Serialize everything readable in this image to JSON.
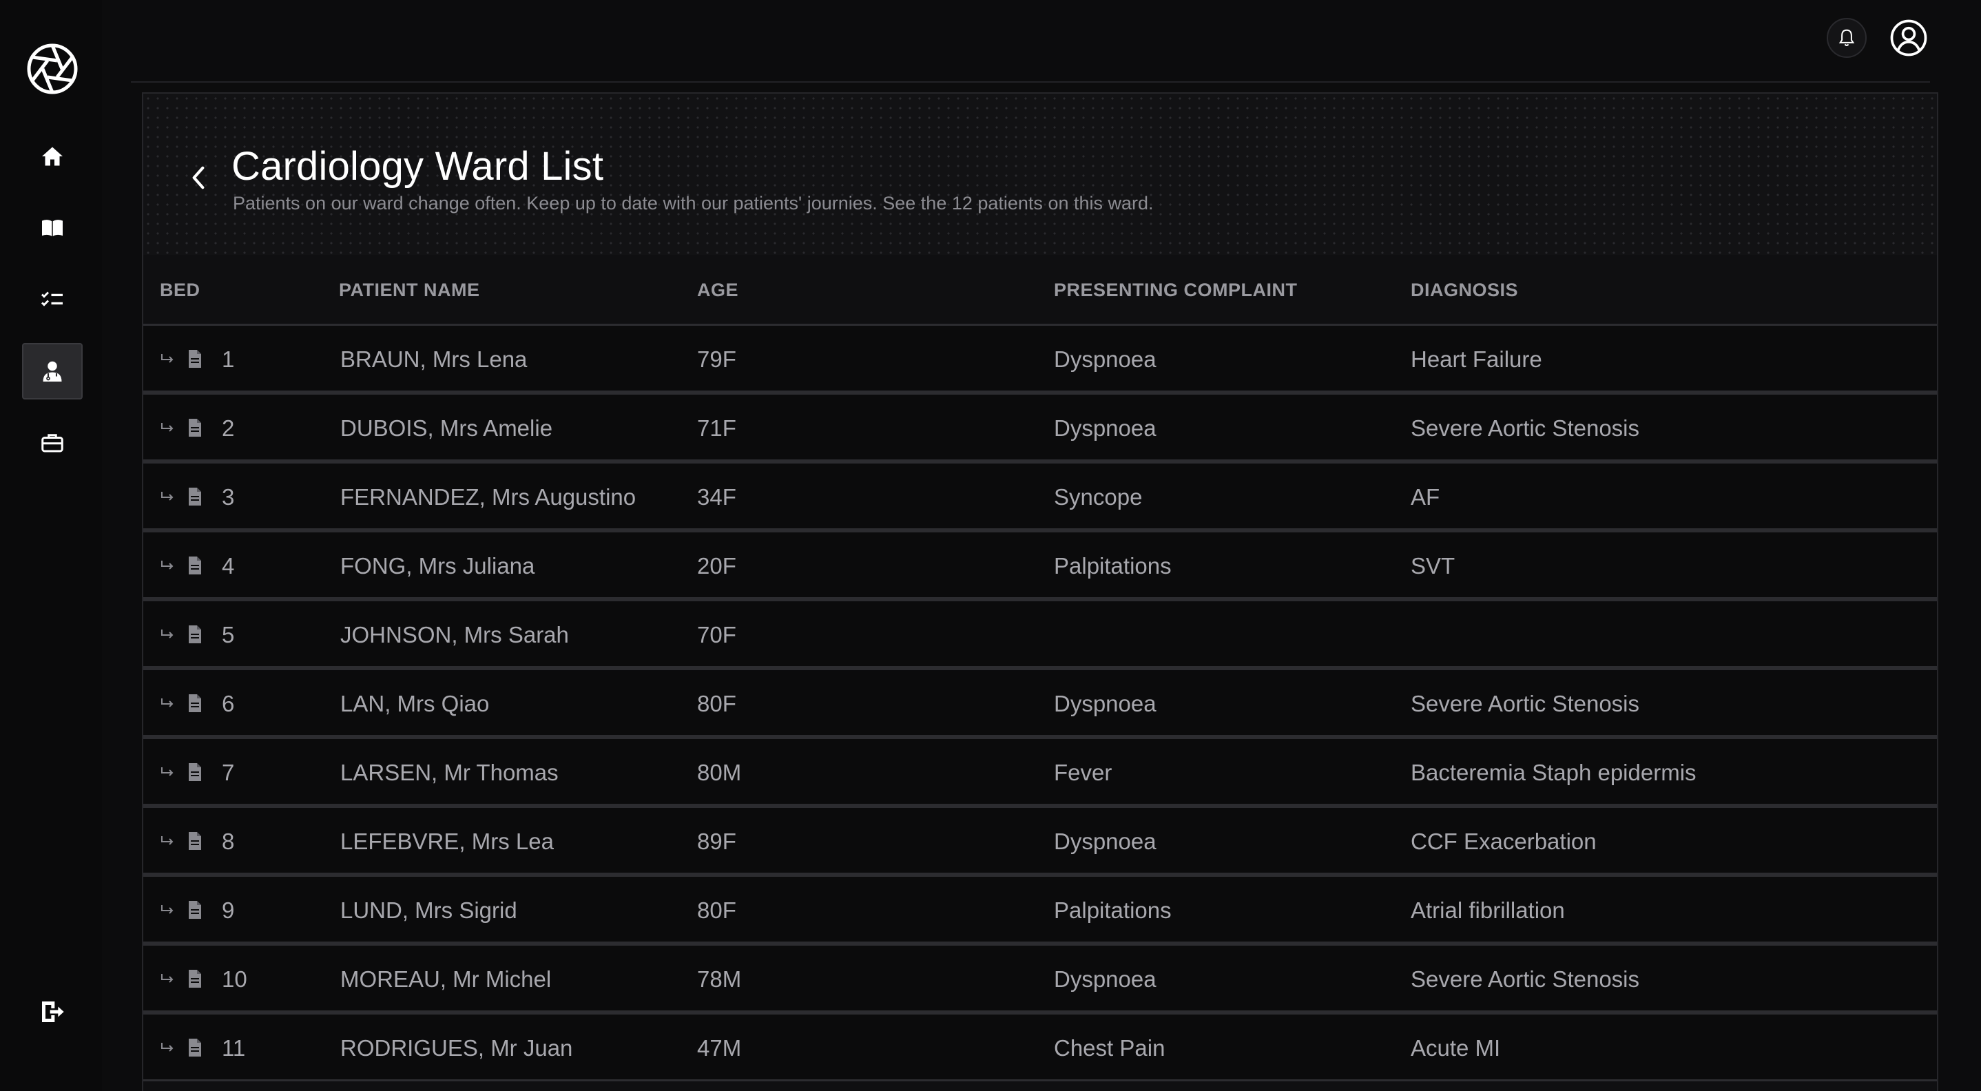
{
  "header": {
    "title": "Cardiology Ward List",
    "subtitle": "Patients on our ward change often. Keep up to date with our patients' journies. See the 12 patients on this ward."
  },
  "sidebar": {
    "items": [
      {
        "icon": "home-icon",
        "active": false
      },
      {
        "icon": "book-icon",
        "active": false
      },
      {
        "icon": "checklist-icon",
        "active": false
      },
      {
        "icon": "doctor-icon",
        "active": true
      },
      {
        "icon": "briefcase-icon",
        "active": false
      }
    ],
    "logout_icon": "logout-icon"
  },
  "topbar": {
    "bell_icon": "bell-icon",
    "user_icon": "user-icon"
  },
  "table": {
    "columns": [
      "BED",
      "PATIENT NAME",
      "AGE",
      "PRESENTING COMPLAINT",
      "DIAGNOSIS"
    ],
    "rows": [
      {
        "bed": "1",
        "name": "BRAUN, Mrs Lena",
        "age": "79F",
        "complaint": "Dyspnoea",
        "diagnosis": "Heart Failure"
      },
      {
        "bed": "2",
        "name": "DUBOIS, Mrs Amelie",
        "age": "71F",
        "complaint": "Dyspnoea",
        "diagnosis": "Severe Aortic Stenosis"
      },
      {
        "bed": "3",
        "name": "FERNANDEZ, Mrs Augustino",
        "age": "34F",
        "complaint": "Syncope",
        "diagnosis": "AF"
      },
      {
        "bed": "4",
        "name": "FONG, Mrs Juliana",
        "age": "20F",
        "complaint": "Palpitations",
        "diagnosis": "SVT"
      },
      {
        "bed": "5",
        "name": "JOHNSON, Mrs Sarah",
        "age": "70F",
        "complaint": "",
        "diagnosis": ""
      },
      {
        "bed": "6",
        "name": "LAN, Mrs Qiao",
        "age": "80F",
        "complaint": "Dyspnoea",
        "diagnosis": "Severe Aortic Stenosis"
      },
      {
        "bed": "7",
        "name": "LARSEN, Mr Thomas",
        "age": "80M",
        "complaint": "Fever",
        "diagnosis": "Bacteremia Staph epidermis"
      },
      {
        "bed": "8",
        "name": "LEFEBVRE, Mrs Lea",
        "age": "89F",
        "complaint": "Dyspnoea",
        "diagnosis": "CCF Exacerbation"
      },
      {
        "bed": "9",
        "name": "LUND, Mrs Sigrid",
        "age": "80F",
        "complaint": "Palpitations",
        "diagnosis": "Atrial fibrillation"
      },
      {
        "bed": "10",
        "name": "MOREAU, Mr Michel",
        "age": "78M",
        "complaint": "Dyspnoea",
        "diagnosis": "Severe Aortic Stenosis"
      },
      {
        "bed": "11",
        "name": "RODRIGUES, Mr Juan",
        "age": "47M",
        "complaint": "Chest Pain",
        "diagnosis": "Acute MI"
      }
    ]
  }
}
